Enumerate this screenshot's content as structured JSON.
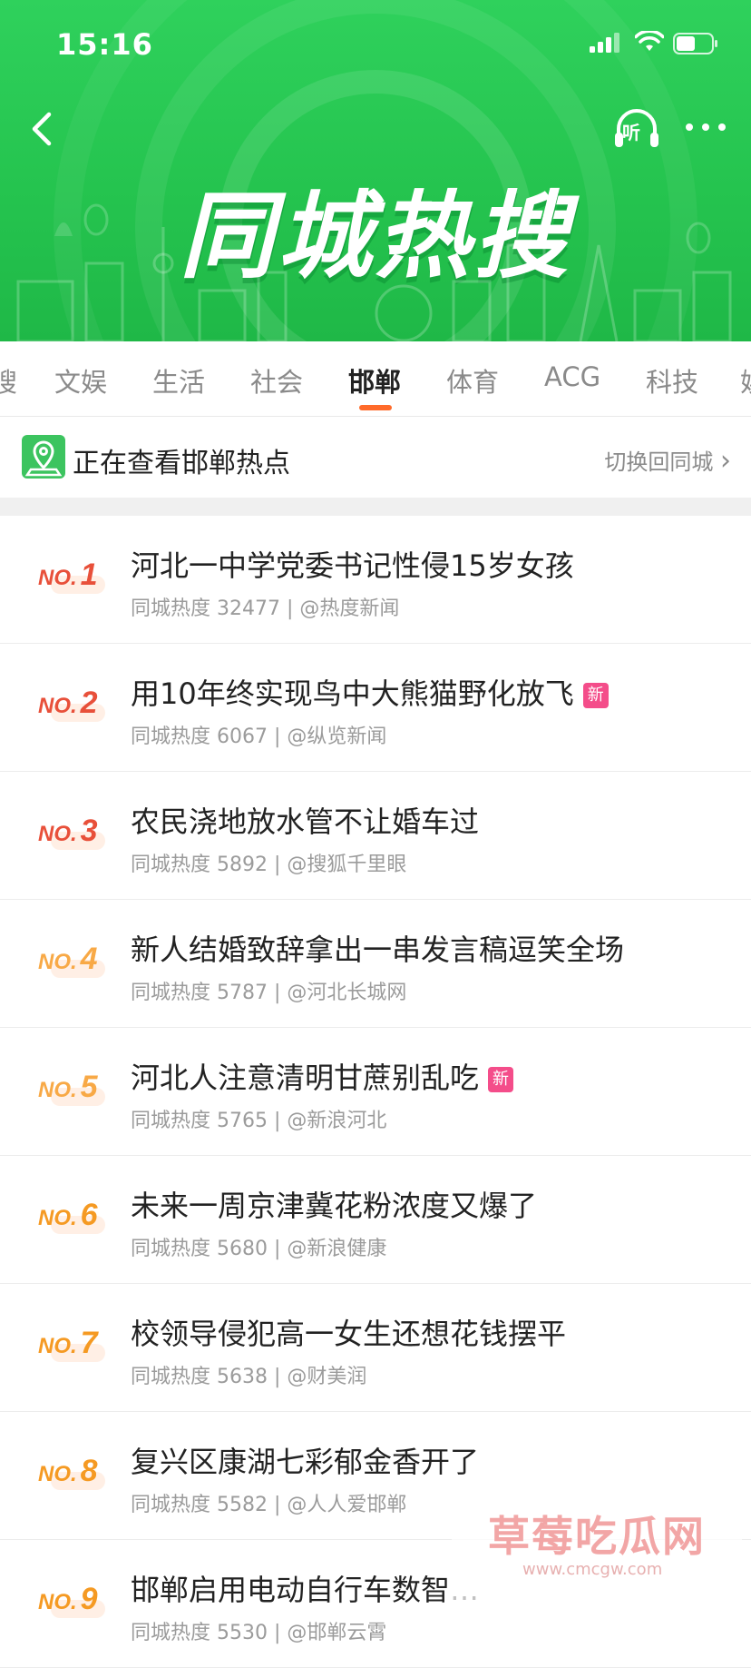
{
  "status_bar": {
    "time": "15:16"
  },
  "header": {
    "title": "同城热搜",
    "listen_label": "听",
    "colors": {
      "primary_green": "#25c44f"
    }
  },
  "tabs": {
    "items": [
      "搜",
      "文娱",
      "生活",
      "社会",
      "邯郸",
      "体育",
      "ACG",
      "科技",
      "娱"
    ],
    "active": "邯郸",
    "accent": "#ff6a2a"
  },
  "location": {
    "text": "正在查看邯郸热点",
    "switch_label": "切换回同城",
    "switch_chevron": "›"
  },
  "list": {
    "new_badge": "新",
    "items": [
      {
        "no": "NO.",
        "rank": "1",
        "title": "河北一中学党委书记性侵15岁女孩",
        "meta": "同城热度 32477 | @热度新闻",
        "new": false
      },
      {
        "no": "NO.",
        "rank": "2",
        "title": "用10年终实现鸟中大熊猫野化放飞",
        "meta": "同城热度 6067 | @纵览新闻",
        "new": true
      },
      {
        "no": "NO.",
        "rank": "3",
        "title": "农民浇地放水管不让婚车过",
        "meta": "同城热度 5892 | @搜狐千里眼",
        "new": false
      },
      {
        "no": "NO.",
        "rank": "4",
        "title": "新人结婚致辞拿出一串发言稿逗笑全场",
        "meta": "同城热度 5787 | @河北长城网",
        "new": false
      },
      {
        "no": "NO.",
        "rank": "5",
        "title": "河北人注意清明甘蔗别乱吃",
        "meta": "同城热度 5765 | @新浪河北",
        "new": true
      },
      {
        "no": "NO.",
        "rank": "6",
        "title": "未来一周京津冀花粉浓度又爆了",
        "meta": "同城热度 5680 | @新浪健康",
        "new": false
      },
      {
        "no": "NO.",
        "rank": "7",
        "title": "校领导侵犯高一女生还想花钱摆平",
        "meta": "同城热度 5638 | @财美润",
        "new": false
      },
      {
        "no": "NO.",
        "rank": "8",
        "title": "复兴区康湖七彩郁金香开了",
        "meta": "同城热度 5582 | @人人爱邯郸",
        "new": false
      },
      {
        "no": "NO.",
        "rank": "9",
        "title": "邯郸启用电动自行车数智…",
        "meta": "同城热度 5530 | @邯郸云霄",
        "new": false
      }
    ]
  },
  "watermark": {
    "text": "草莓吃瓜网",
    "url": "www.cmcgw.com"
  }
}
